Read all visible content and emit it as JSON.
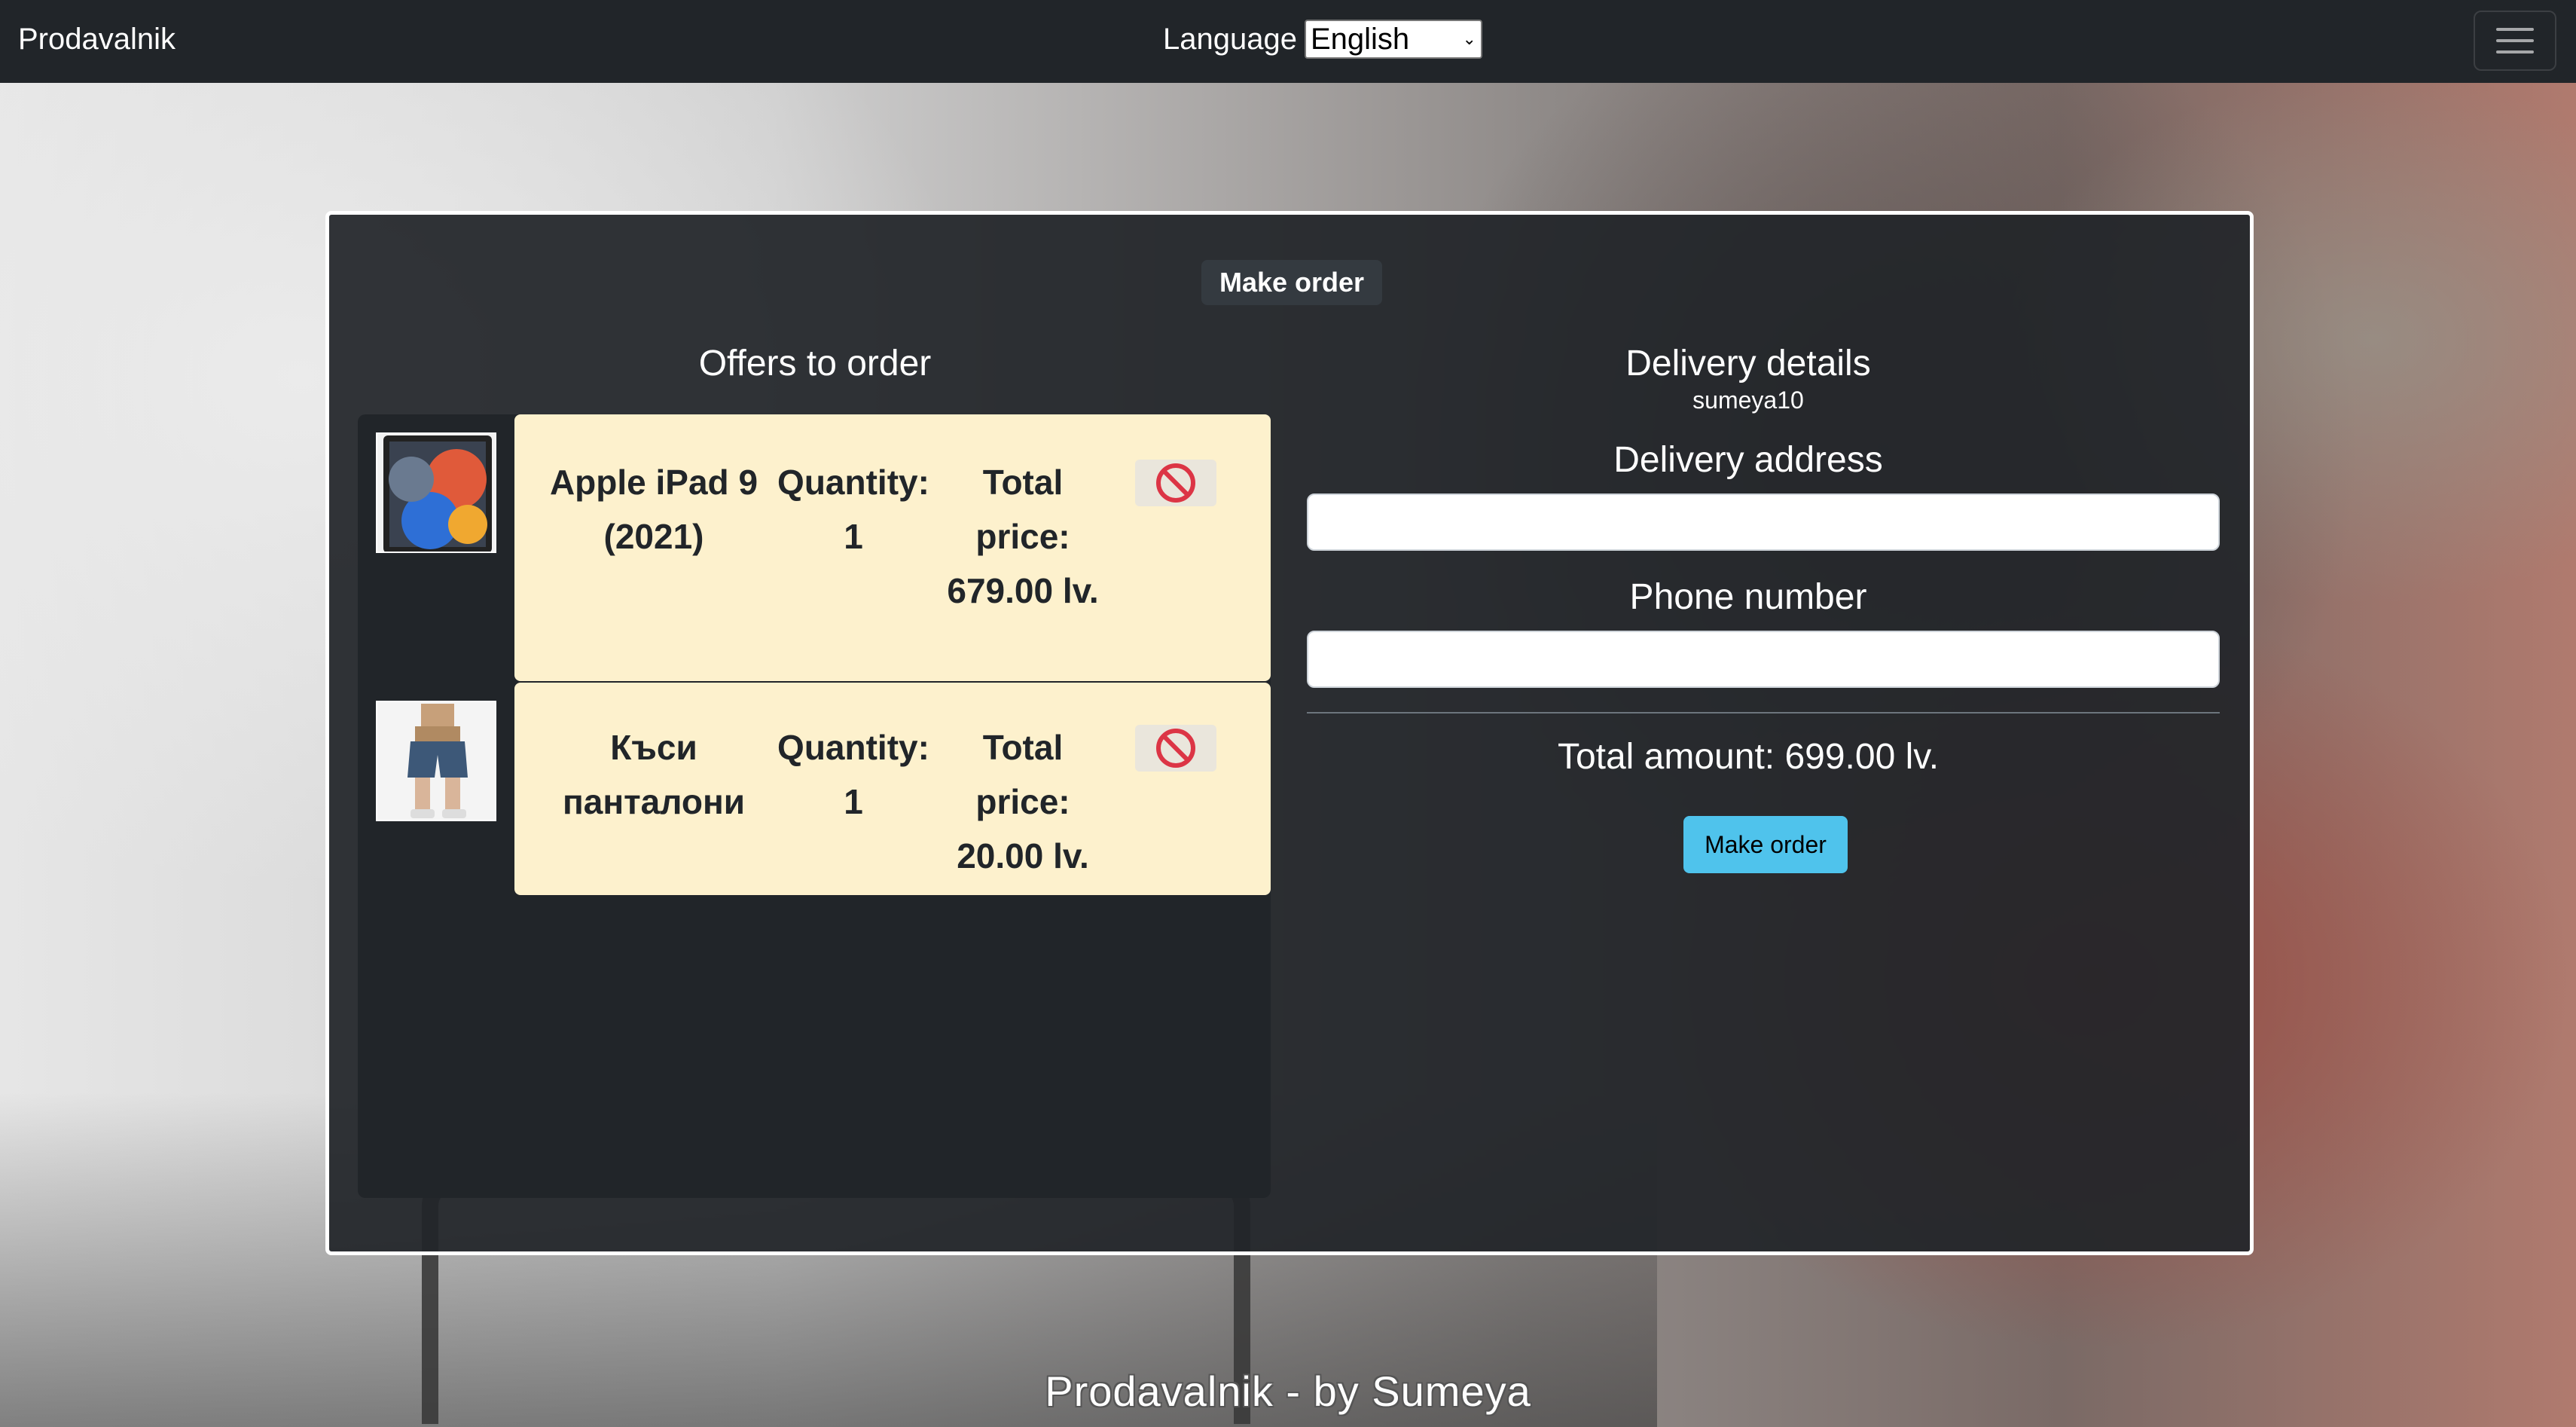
{
  "navbar": {
    "brand": "Prodavalnik",
    "language_label": "Language",
    "language_selected": "English",
    "menu_icon": "hamburger-icon"
  },
  "panel": {
    "title": "Make order",
    "offers_heading": "Offers to order",
    "offers": [
      {
        "name": "Apple iPad 9 (2021)",
        "quantity_label": "Quantity:",
        "quantity": "1",
        "total_price": "Total price: 679.00 lv.",
        "image_icon": "tablet-image",
        "remove_icon": "prohibited-icon"
      },
      {
        "name": "Къси панталони",
        "quantity_label": "Quantity:",
        "quantity": "1",
        "total_price": "Total price: 20.00 lv.",
        "image_icon": "shorts-image",
        "remove_icon": "prohibited-icon"
      }
    ],
    "delivery": {
      "heading": "Delivery details",
      "username": "sumeya10",
      "address_label": "Delivery address",
      "address_value": "",
      "phone_label": "Phone number",
      "phone_value": "",
      "total_amount": "Total amount: 699.00 lv.",
      "order_button": "Make order"
    }
  },
  "footer": {
    "text": "Prodavalnik - by Sumeya"
  },
  "colors": {
    "navbar": "#212529",
    "card": "#fdf1cd",
    "order_button": "#4fc3ec",
    "remove_icon": "#dc3545"
  }
}
